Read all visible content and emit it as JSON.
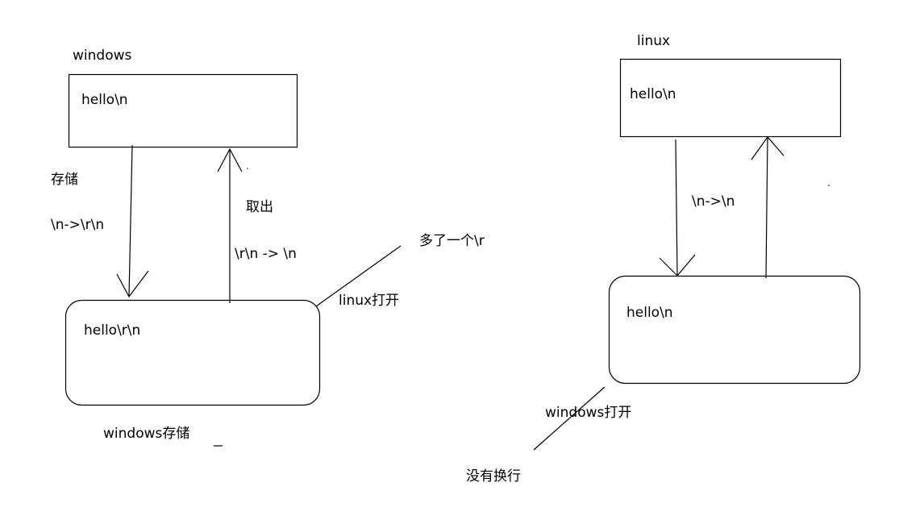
{
  "left": {
    "title": "windows",
    "top_box_text": "hello\\n",
    "store_label": "存储",
    "store_conversion": "\\n->\\r\\n",
    "retrieve_label": "取出",
    "retrieve_conversion": "\\r\\n -> \\n",
    "bottom_box_text": "hello\\r\\n",
    "bottom_caption": "windows存储",
    "open_label": "linux打开",
    "open_result": "多了一个\\r"
  },
  "right": {
    "title": "linux",
    "top_box_text": "hello\\n",
    "conversion": "\\n->\\n",
    "bottom_box_text": "hello\\n",
    "open_label": "windows打开",
    "open_result": "没有换行"
  }
}
